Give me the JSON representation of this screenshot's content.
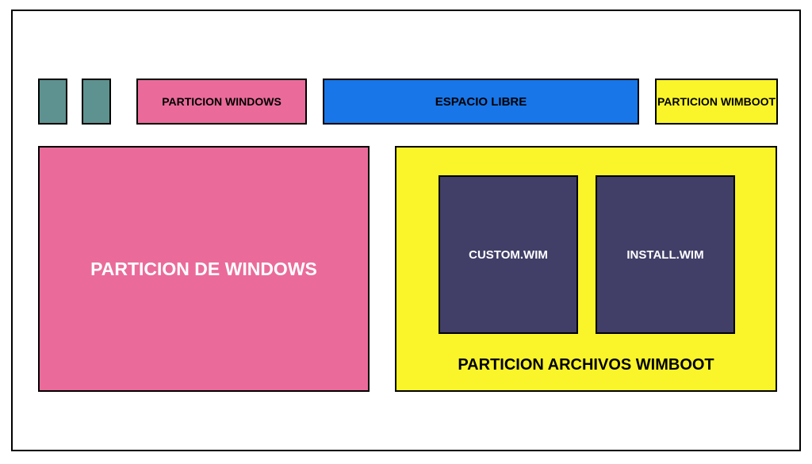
{
  "top_row": {
    "partition_windows_label": "PARTICION WINDOWS",
    "free_space_label": "ESPACIO LIBRE",
    "partition_wimboot_label": "PARTICION WIMBOOT"
  },
  "bottom_row": {
    "partition_windows_large_label": "PARTICION DE WINDOWS",
    "wimboot": {
      "files": {
        "custom": "CUSTOM.WIM",
        "install": "INSTALL.WIM"
      },
      "label": "PARTICION ARCHIVOS WIMBOOT"
    }
  },
  "colors": {
    "teal": "#5e9290",
    "pink": "#ea6b9a",
    "blue": "#1876e8",
    "yellow": "#faf52a",
    "darkpurple": "#413f67"
  }
}
